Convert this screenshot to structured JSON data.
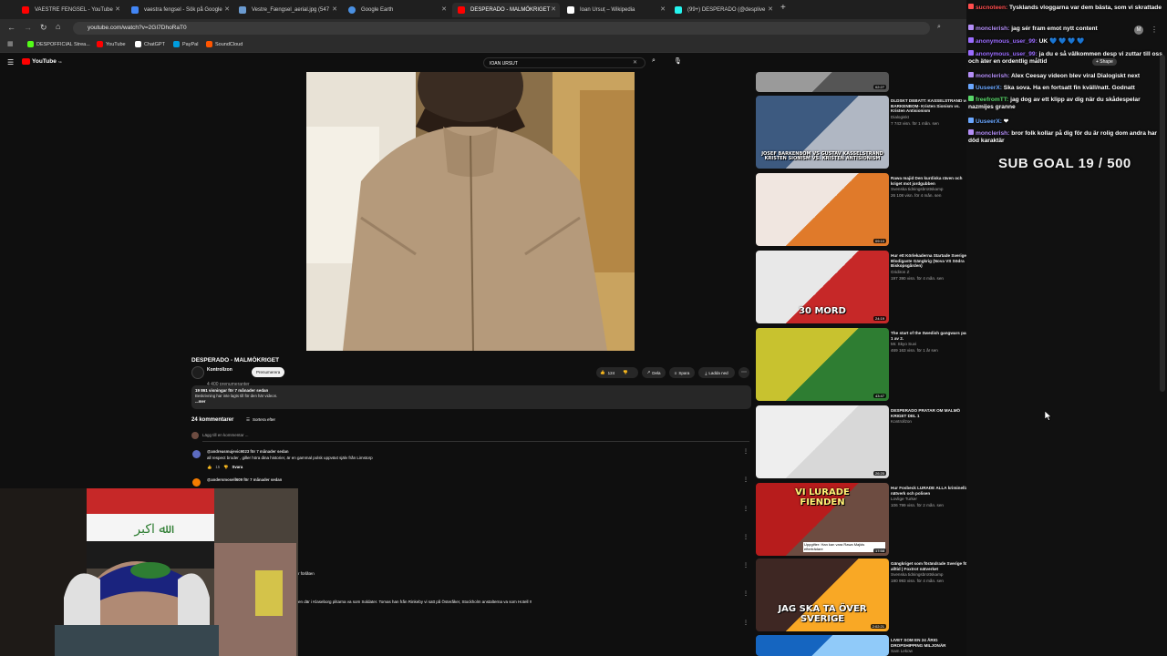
{
  "tabs": [
    {
      "label": "VAESTRE FENGSEL - YouTube",
      "favicon_color": "#ff0000"
    },
    {
      "label": "vaestra fengsel - Sök på Google",
      "favicon_color": "#4285f4"
    },
    {
      "label": "Vestre_Fængsel_aerial.jpg (547",
      "favicon_color": "#6b9bd1"
    },
    {
      "label": "Google Earth",
      "favicon_color": "#4a90e2"
    },
    {
      "label": "DESPERADO - MALMÖKRIGET",
      "favicon_color": "#ff0000"
    },
    {
      "label": "Ioan Ursuț – Wikipedia",
      "favicon_color": "#ffffff"
    },
    {
      "label": "(99+) DESPERADO (@desplive",
      "favicon_color": "#25f4ee"
    }
  ],
  "new_tab": "+",
  "url": "youtube.com/watch?v=2GI7DhoRaT0",
  "bookmarks": [
    {
      "label": "DESPOFFICIAL Strea...",
      "color": "#53fc18"
    },
    {
      "label": "YouTube",
      "color": "#ff0000"
    },
    {
      "label": "ChatGPT",
      "color": "#ffffff"
    },
    {
      "label": "PayPal",
      "color": "#009cde"
    },
    {
      "label": "SoundCloud",
      "color": "#ff5500"
    }
  ],
  "yt": {
    "logo": "YouTube",
    "logo_sup": "SE",
    "search_value": "IOAN URSUT",
    "video_title": "DESPERADO - MALMÖKRIGET",
    "channel_name": "Kontrollzon",
    "subscribers": "4 400 prenumeranter",
    "subscribe_label": "Prenumerera",
    "like_count": "124",
    "share_label": "Dela",
    "save_label": "Spara",
    "download_label": "Ladda ned",
    "views_line": "19 861 visningar  för 7 månader sedan",
    "desc_line": "Beskrivning har inte lagts till för den här videon.",
    "desc_more": "...mer",
    "comments_count": "24 kommentarer",
    "sort_label": "Sortera efter",
    "add_comment": "Lägg till en kommentar ...",
    "comments": [
      {
        "author": "@andreasmujevic9023  för 7 månader sedan",
        "text": "all respect broder , giller höra dina historier, är en gammal polsk uppväxt själv från Limstorp",
        "likes": "15",
        "reply": "Svara",
        "avatar_color": "#5c6bc0"
      },
      {
        "author": "@andersmosell609  för 7 månader sedan",
        "text": "",
        "avatar_color": "#f57c00"
      }
    ],
    "partial_texts": [
      "r förlåten",
      "en där i Klaseborg plitarna va som Soldater. Tomas han från Rinkeby vi satt på Österåker, Stockholm anstalterna va som Hotell !!"
    ]
  },
  "recommendations": [
    {
      "title": "",
      "meta": "",
      "duration": "02:27",
      "colors": [
        "#9a9a9a",
        "#555555"
      ]
    },
    {
      "title": "DLDSKT DEBATT: KASSELSTRAND vs BARKENBOM- Kristen Sionism vs. Kristen Antisionism",
      "meta": "Dialogiskt\n7 743 visn. för 1 mån. sen",
      "duration": "",
      "caption": "JOSEF BARKENBOM VS GUSTAV KASSELSTRAND\nKRISTEN SIONISM VS. KRISTEN ANTISIONISM",
      "colors": [
        "#3d5a80",
        "#b0b7c3"
      ]
    },
    {
      "title": "Rawa majid Den kurdiska räven och kriget mot jordgubben",
      "meta": "Svenska tidningsbrottskamp\n26 108 visn. för 4 mån. sen",
      "duration": "09:10",
      "colors": [
        "#f0e6e0",
        "#e07a2a"
      ]
    },
    {
      "title": "Hur ett Körlekaderna Startade Sveriges Blodigaste Gängkrig (Nova VS Södra Biskopsgården)",
      "meta": "Gridiron Z\n197 390 visn. för 4 mån. sen",
      "duration": "24:19",
      "caption": "30 MORD",
      "colors": [
        "#e8e8e8",
        "#c62828"
      ]
    },
    {
      "title": "The start of the Swedish gangwars part 1 av 2.",
      "meta": "Mr. Skyo Suvi\n469 163 visn. för 1 år sen",
      "duration": "43:47",
      "colors": [
        "#c8c22f",
        "#2e7d32"
      ]
    },
    {
      "title": "DESPERADO PRATAR OM MALMÖ KRIGET DEL 1",
      "meta": "Kontrollzon\n",
      "duration": "26:20",
      "colors": [
        "#eeeeee",
        "#d8d8d8"
      ]
    },
    {
      "title": "Hur Fosbeck LURADE ALLA kriminella nätverk och polisen",
      "meta": "Lovlige Turker\n106 799 visn. för 2 mån. sen",
      "duration": "17:58",
      "caption": "VI LURADE\nFIENDEN",
      "sub_caption": "Uppgifter: Han kan vara Rawa Majids efterträdare",
      "colors": [
        "#b71c1c",
        "#6d4c41"
      ]
    },
    {
      "title": "Gängkriget som förändrade Sverige för alltid | Foxtrot nätverket",
      "meta": "Svenska tidningsbrottskamp\n190 993 visn. för 4 mån. sen",
      "duration": "2:02:21",
      "caption": "JAG SKA TA ÖVER SVERIGE",
      "colors": [
        "#3e2723",
        "#f9a825"
      ]
    },
    {
      "title": "LIVET SOM EN 24 ÅRIG DROPSHIPPING MILJONÄR",
      "meta": "Sam Lekow",
      "duration": "",
      "colors": [
        "#1565c0",
        "#90caf9"
      ]
    }
  ],
  "chat": {
    "lines": [
      {
        "user": "sucnoteen:",
        "text": "Tysklands vloggarna var dem bästa, som vi skrattade",
        "color": "#ff4d4d"
      },
      {
        "user": "monclerish:",
        "text": "jag sér fram emot nytt content",
        "color": "#b48ef7"
      },
      {
        "user": "anonymous_user_99:",
        "text": "UK 💙 💙 💙 💙",
        "color": "#9b6cff"
      },
      {
        "user": "anonymous_user_99:",
        "text": "ja du e så välkommen desp vi zuttar till oss och äter en ordentlig måltid",
        "color": "#9b6cff"
      },
      {
        "user": "monclerish:",
        "text": "Alex Ceesay videon blev viral Dialogiskt next",
        "color": "#b48ef7"
      },
      {
        "user": "UuseerX:",
        "text": "Ska sova. Ha en fortsatt fin kväll/natt. Godnatt",
        "color": "#6aa7ff"
      },
      {
        "user": "freefromTT:",
        "text": "jag dog av ett klipp av dig när du skådespelar nazmijes granne",
        "color": "#59d66a"
      },
      {
        "user": "UuseerX:",
        "text": "❤",
        "color": "#6aa7ff"
      },
      {
        "user": "monclerish:",
        "text": "bror folk kollar på dig för du är rolig dom andra har död karaktär",
        "color": "#b48ef7"
      }
    ],
    "sub_goal": "SUB GOAL 19 / 500"
  },
  "icons": [
    "back-arrow-icon",
    "forward-arrow-icon",
    "reload-icon",
    "home-icon",
    "menu-icon",
    "search-icon",
    "mic-icon",
    "like-icon",
    "dislike-icon",
    "share-icon",
    "save-icon",
    "download-icon",
    "more-icon",
    "cursor-icon"
  ]
}
